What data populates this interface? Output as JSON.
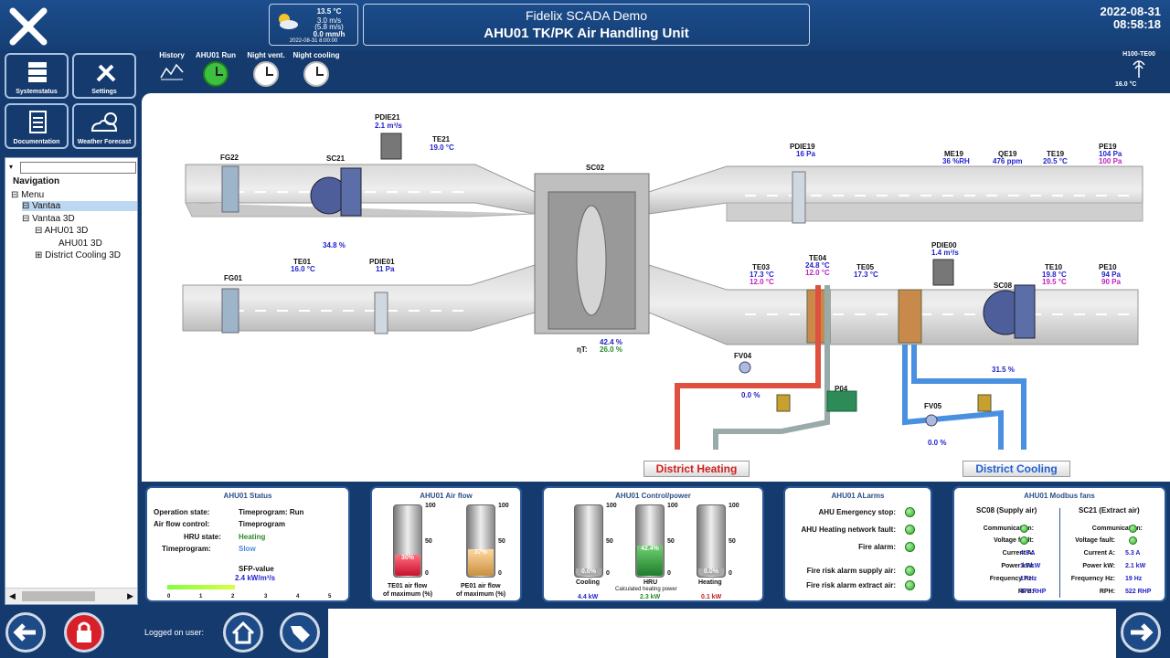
{
  "header": {
    "title": "Fidelix SCADA Demo",
    "subtitle": "AHU01 TK/PK Air Handling Unit",
    "date": "2022-08-31",
    "time": "08:58:18"
  },
  "weather": {
    "temp": "13.5 °C",
    "wind": "3.0 m/s",
    "gust": "(5.8 m/s)",
    "rain": "0.0 mm/h",
    "stamp": "2022-08-31 8:00:00"
  },
  "tiles": [
    {
      "label": "Systemstatus"
    },
    {
      "label": "Settings"
    },
    {
      "label": "Documentation"
    },
    {
      "label": "Weather Forecast"
    }
  ],
  "nav": {
    "title": "Navigation",
    "items": [
      "Menu",
      "Vantaa",
      "Vantaa 3D",
      "AHU01 3D",
      "AHU01 3D",
      "District Cooling 3D"
    ]
  },
  "tools": {
    "history": "History",
    "run": "AHU01 Run",
    "vent": "Night vent.",
    "cool": "Night cooling"
  },
  "sensor": {
    "name": "H100-TE00",
    "value": "16.0 °C"
  },
  "diagram": {
    "fg22": "FG22",
    "sc21": "SC21",
    "sc21v": "34.8 %",
    "pdie21": "PDIE21",
    "pdie21v": "2.1 m³/s",
    "te21": "TE21",
    "te21v": "19.0 °C",
    "sc02": "SC02",
    "sc02v": "42.4 %",
    "nt": "ηT:",
    "ntv": "26.0 %",
    "pdie19": "PDIE19",
    "pdie19v": "16 Pa",
    "me19": "ME19",
    "me19v": "36 %RH",
    "qe19": "QE19",
    "qe19v": "476 ppm",
    "te19": "TE19",
    "te19v": "20.5 °C",
    "pe19": "PE19",
    "pe19v1": "104 Pa",
    "pe19v2": "100 Pa",
    "fg01": "FG01",
    "te01": "TE01",
    "te01v": "16.0 °C",
    "pdie01": "PDIE01",
    "pdie01v": "11 Pa",
    "te03": "TE03",
    "te03v1": "17.3 °C",
    "te03v2": "12.0 °C",
    "te04": "TE04",
    "te04v1": "24.8 °C",
    "te04v2": "12.0 °C",
    "te05": "TE05",
    "te05v": "17.3 °C",
    "pdie00": "PDIE00",
    "pdie00v": "1.4 m³/s",
    "sc08": "SC08",
    "sc08v": "31.5 %",
    "te10": "TE10",
    "te10v1": "19.8 °C",
    "te10v2": "19.5 °C",
    "pe10": "PE10",
    "pe10v1": "94 Pa",
    "pe10v2": "90 Pa",
    "fv04": "FV04",
    "fv04v": "0.0 %",
    "p04": "P04",
    "fv05": "FV05",
    "fv05v": "0.0 %",
    "heating": "District Heating",
    "cooling": "District Cooling"
  },
  "status": {
    "title": "AHU01 Status",
    "op_l": "Operation state:",
    "op_v": "Timeprogram: Run",
    "af_l": "Air flow control:",
    "af_v": "Timeprogram",
    "hru_l": "HRU state:",
    "hru_v": "Heating",
    "tp_l": "Timeprogram:",
    "tp_v": "Slow",
    "sfp_l": "SFP-value",
    "sfp_v": "2.4 kW/m³/s",
    "scale": [
      "0",
      "1",
      "2",
      "3",
      "4",
      "5"
    ]
  },
  "airflow": {
    "title": "AHU01 Air flow",
    "b1": "30%",
    "b2": "37%",
    "l1": "TE01 air flow",
    "l1b": "of maximum (%)",
    "l2": "PE01 air flow",
    "l2b": "of maximum (%)",
    "t100": "100",
    "t50": "50",
    "t0": "0"
  },
  "control": {
    "title": "AHU01 Control/power",
    "c": "0.0%",
    "h": "42.4%",
    "ht": "0.0%",
    "cl": "Cooling",
    "hl": "HRU",
    "htl": "Heating",
    "calc": "Calculated heating power",
    "ckw": "4.4 kW",
    "hkw": "2.3 kW",
    "htkw": "0.1 kW"
  },
  "alarms": {
    "title": "AHU01 ALarms",
    "a1": "AHU Emergency stop:",
    "a2": "AHU Heating network fault:",
    "a3": "Fire alarm:",
    "a4": "Fire risk alarm supply air:",
    "a5": "Fire risk alarm extract air:"
  },
  "fans": {
    "title": "AHU01 Modbus fans",
    "s1": "SC08 (Supply air)",
    "s2": "SC21 (Extract air)",
    "comm": "Communication:",
    "volt": "Voltage fault:",
    "cur": "Current A:",
    "pow": "Power kW:",
    "freq": "Frequency Hz:",
    "rph": "RPH:",
    "s1cur": "4.8 A",
    "s1pow": "1.9 kW",
    "s1freq": "17 Hz",
    "s1rph": "472 RHP",
    "s2cur": "5.3 A",
    "s2pow": "2.1 kW",
    "s2freq": "19 Hz",
    "s2rph": "522 RHP"
  },
  "footer": {
    "logged": "Logged on user:"
  }
}
